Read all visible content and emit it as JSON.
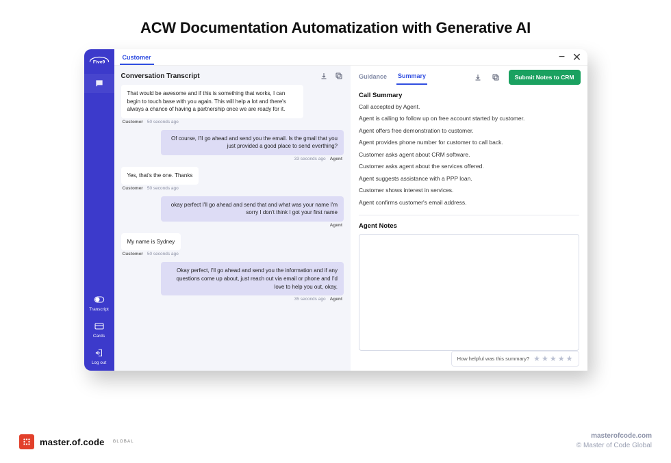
{
  "page_title": "ACW Documentation Automatization with Generative AI",
  "brand": {
    "name": "Five9",
    "domain": "masterofcode.com",
    "copyright": "© Master of Code Global",
    "moc_label": "master.of.code",
    "moc_sub": "GLOBAL"
  },
  "topbar": {
    "customer_tab": "Customer"
  },
  "sidebar": {
    "transcript": "Transcript",
    "cards": "Cards",
    "logout": "Log out"
  },
  "transcript": {
    "title": "Conversation Transcript",
    "customer_label": "Customer",
    "agent_label": "Agent",
    "messages": [
      {
        "role": "customer",
        "text": "That would be awesome and if this is something that works, I can begin to touch base with you again. This will help a lot and there's always a chance of having a partnership once we are ready for it.",
        "time": "50 seconds ago"
      },
      {
        "role": "agent",
        "text": "Of course, I'll go ahead and send you the email. Is the gmail that you just provided a good place to send everthing?",
        "time": "33 seconds ago"
      },
      {
        "role": "customer",
        "text": "Yes, that's the one. Thanks",
        "time": "50 seconds ago"
      },
      {
        "role": "agent",
        "text": "okay perfect I'll go ahead and send that and what was your name I'm sorry I don't think I got your first name",
        "time": ""
      },
      {
        "role": "customer",
        "text": "My name is Sydney",
        "time": "50 seconds ago"
      },
      {
        "role": "agent",
        "text": "Okay perfect, I'll go ahead and send you the information and if any questions come up about, just reach out via email or phone and I'd love to help you out, okay.",
        "time": "35 seconds ago"
      }
    ]
  },
  "summary": {
    "tabs": {
      "guidance": "Guidance",
      "summary": "Summary"
    },
    "submit_label": "Submit Notes to CRM",
    "heading": "Call Summary",
    "lines": [
      "Call accepted by Agent.",
      "Agent is calling to follow up on free account started by customer.",
      "Agent offers free demonstration to customer.",
      "Agent provides phone number for customer to call back.",
      "Customer asks agent about CRM software.",
      "Customer asks agent about the services offered.",
      "Agent suggests assistance with a PPP loan.",
      "Customer shows interest in services.",
      "Agent confirms customer's email address."
    ],
    "notes_heading": "Agent Notes",
    "feedback_prompt": "How helpful was this summary?"
  }
}
